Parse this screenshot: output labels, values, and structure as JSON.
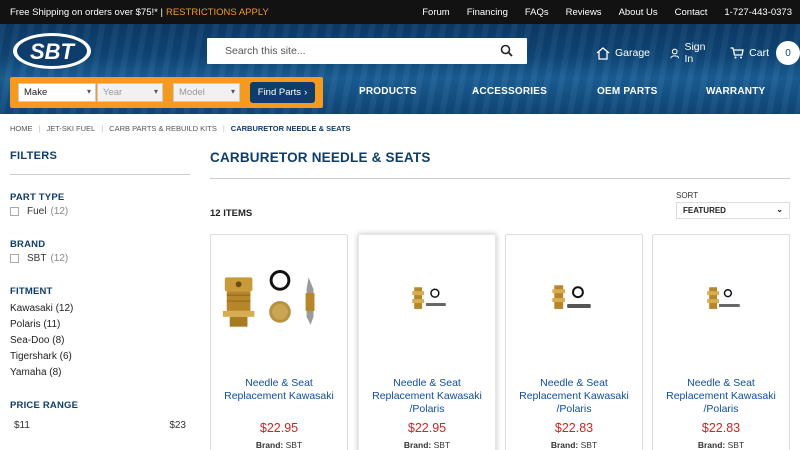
{
  "topbar": {
    "promo": "Free Shipping on orders over $75!* |",
    "restrictions": "RESTRICTIONS APPLY",
    "links": [
      "Forum",
      "Financing",
      "FAQs",
      "Reviews",
      "About Us",
      "Contact",
      "1-727-443-0373"
    ]
  },
  "header": {
    "logo_text": "SBT",
    "search_placeholder": "Search this site...",
    "garage": "Garage",
    "signin": "Sign In",
    "cart": "Cart",
    "cart_count": "0"
  },
  "finder": {
    "make": "Make",
    "year": "Year",
    "model": "Model",
    "button": "Find Parts"
  },
  "nav": [
    {
      "label": "PRODUCTS",
      "caret": true
    },
    {
      "label": "ACCESSORIES",
      "caret": true
    },
    {
      "label": "OEM PARTS",
      "caret": false
    },
    {
      "label": "WARRANTY",
      "caret": false
    }
  ],
  "breadcrumb": [
    "HOME",
    "JET-SKI FUEL",
    "CARB PARTS & REBUILD KITS",
    "CARBURETOR NEEDLE & SEATS"
  ],
  "sidebar": {
    "title": "FILTERS",
    "part_type": {
      "heading": "PART TYPE",
      "options": [
        {
          "label": "Fuel",
          "count": "(12)"
        }
      ]
    },
    "brand": {
      "heading": "BRAND",
      "options": [
        {
          "label": "SBT",
          "count": "(12)"
        }
      ]
    },
    "fitment": {
      "heading": "FITMENT",
      "items": [
        "Kawasaki (12)",
        "Polaris (11)",
        "Sea-Doo (8)",
        "Tigershark (6)",
        "Yamaha (8)"
      ]
    },
    "price_range": {
      "heading": "PRICE RANGE",
      "min": "$11",
      "max": "$23"
    }
  },
  "main": {
    "title": "CARBURETOR NEEDLE & SEATS",
    "items_count": "12 ITEMS",
    "sort_label": "SORT",
    "sort_value": "FEATURED"
  },
  "products": [
    {
      "name": "Needle & Seat Replacement Kawasaki",
      "price": "$22.95",
      "brand_label": "Brand:",
      "brand": "SBT"
    },
    {
      "name": "Needle & Seat Replacement Kawasaki /Polaris",
      "price": "$22.95",
      "brand_label": "Brand:",
      "brand": "SBT"
    },
    {
      "name": "Needle & Seat Replacement Kawasaki /Polaris",
      "price": "$22.83",
      "brand_label": "Brand:",
      "brand": "SBT"
    },
    {
      "name": "Needle & Seat Replacement Kawasaki /Polaris",
      "price": "$22.83",
      "brand_label": "Brand:",
      "brand": "SBT"
    }
  ],
  "colors": {
    "brand_blue": "#0f3d6b",
    "accent_orange": "#f39a1f",
    "price_red": "#d32222",
    "link_blue": "#0f4ea3"
  }
}
